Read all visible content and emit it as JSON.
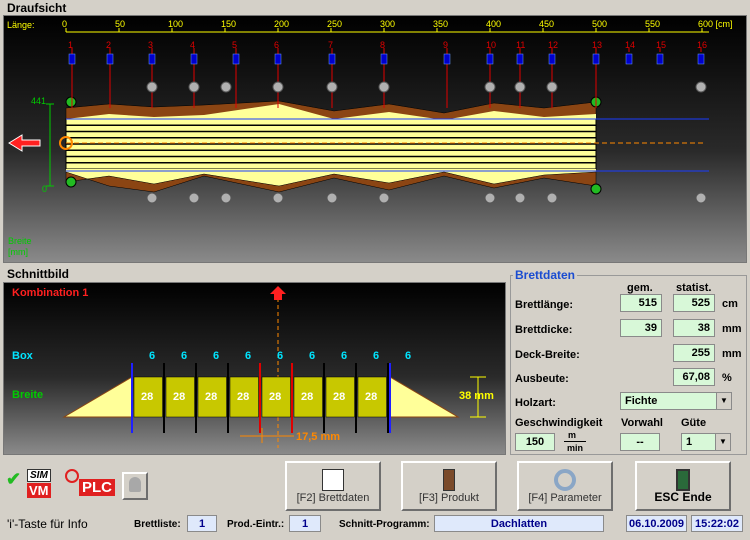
{
  "draufsicht": {
    "title": "Draufsicht",
    "laenge_label": "Länge:",
    "scale_ticks": [
      "0",
      "50",
      "100",
      "150",
      "200",
      "250",
      "300",
      "350",
      "400",
      "450",
      "500",
      "550",
      "600 [cm]"
    ],
    "saw_numbers": [
      "1",
      "2",
      "3",
      "4",
      "5",
      "6",
      "7",
      "8",
      "9",
      "10",
      "11",
      "12",
      "13",
      "14",
      "15",
      "16"
    ],
    "y_top": "441",
    "y_bottom": "0",
    "breite_label": "Breite",
    "breite_unit": "[mm]",
    "arrow_icon": "left-arrow-icon"
  },
  "schnittbild": {
    "title": "Schnittbild",
    "kombination": "Kombination  1",
    "box_label": "Box",
    "breite_label": "Breite",
    "box_values": [
      "6",
      "6",
      "6",
      "6",
      "6",
      "6",
      "6",
      "6",
      "6"
    ],
    "breite_values": [
      "28",
      "28",
      "28",
      "28",
      "28",
      "28",
      "28",
      "28"
    ],
    "thickness": "38 mm",
    "offset": "17,5 mm"
  },
  "brettdaten": {
    "title": "Brettdaten",
    "col_gem": "gem.",
    "col_statist": "statist.",
    "brettlaenge_label": "Brettlänge:",
    "brettlaenge_gem": "515",
    "brettlaenge_stat": "525",
    "brettlaenge_unit": "cm",
    "brettdicke_label": "Brettdicke:",
    "brettdicke_gem": "39",
    "brettdicke_stat": "38",
    "brettdicke_unit": "mm",
    "deckbreite_label": "Deck-Breite:",
    "deckbreite_stat": "255",
    "deckbreite_unit": "mm",
    "ausbeute_label": "Ausbeute:",
    "ausbeute_stat": "67,08",
    "ausbeute_unit": "%",
    "holzart_label": "Holzart:",
    "holzart_value": "Fichte",
    "geschw_label": "Geschwindigkeit",
    "geschw_value": "150",
    "geschw_unit_top": "m",
    "geschw_unit_bottom": "min",
    "vorwahl_label": "Vorwahl",
    "vorwahl_value": "--",
    "guete_label": "Güte",
    "guete_value": "1"
  },
  "toolbar": {
    "sim_label": "SIM",
    "vm_label": "VM",
    "plc_label": "PLC",
    "f2_label": "[F2] Brettdaten",
    "f3_label": "[F3] Produkt",
    "f4_label": "[F4] Parameter",
    "esc_label": "ESC Ende"
  },
  "statusbar": {
    "info": "'i'-Taste für Info",
    "brettliste_label": "Brettliste:",
    "brettliste_value": "1",
    "prod_label": "Prod.-Eintr.:",
    "prod_value": "1",
    "programm_label": "Schnitt-Programm:",
    "programm_value": "Dachlatten",
    "date": "06.10.2009",
    "time": "15:22:02"
  },
  "colors": {
    "board_yellow": "#ffff99",
    "wood_brown": "#8b4513",
    "saw_red": "#e00000",
    "saw_blue": "#0000cc",
    "scale_yellow": "#ffff00",
    "box_cyan": "#00e5ff",
    "green_label": "#00cc00"
  }
}
